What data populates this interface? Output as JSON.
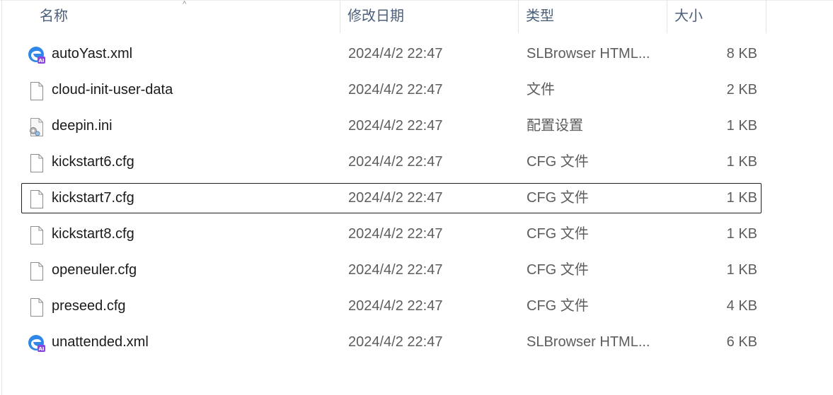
{
  "header": {
    "name": "名称",
    "date": "修改日期",
    "type": "类型",
    "size": "大小",
    "sort_indicator": "^"
  },
  "files": [
    {
      "name": "autoYast.xml",
      "date": "2024/4/2 22:47",
      "type": "SLBrowser HTML...",
      "size": "8 KB",
      "icon": "slbrowser-html-icon"
    },
    {
      "name": "cloud-init-user-data",
      "date": "2024/4/2 22:47",
      "type": "文件",
      "size": "2 KB",
      "icon": "blank-file-icon"
    },
    {
      "name": "deepin.ini",
      "date": "2024/4/2 22:47",
      "type": "配置设置",
      "size": "1 KB",
      "icon": "config-settings-icon"
    },
    {
      "name": "kickstart6.cfg",
      "date": "2024/4/2 22:47",
      "type": "CFG 文件",
      "size": "1 KB",
      "icon": "blank-file-icon"
    },
    {
      "name": "kickstart7.cfg",
      "date": "2024/4/2 22:47",
      "type": "CFG 文件",
      "size": "1 KB",
      "icon": "blank-file-icon",
      "focused": true
    },
    {
      "name": "kickstart8.cfg",
      "date": "2024/4/2 22:47",
      "type": "CFG 文件",
      "size": "1 KB",
      "icon": "blank-file-icon"
    },
    {
      "name": "openeuler.cfg",
      "date": "2024/4/2 22:47",
      "type": "CFG 文件",
      "size": "1 KB",
      "icon": "blank-file-icon"
    },
    {
      "name": "preseed.cfg",
      "date": "2024/4/2 22:47",
      "type": "CFG 文件",
      "size": "4 KB",
      "icon": "blank-file-icon"
    },
    {
      "name": "unattended.xml",
      "date": "2024/4/2 22:47",
      "type": "SLBrowser HTML...",
      "size": "6 KB",
      "icon": "slbrowser-html-icon"
    }
  ],
  "colors": {
    "header_text": "#4c607a",
    "name_text": "#1a1a1a",
    "detail_text": "#5d5d5d",
    "focus_border": "#1f1f1f"
  }
}
